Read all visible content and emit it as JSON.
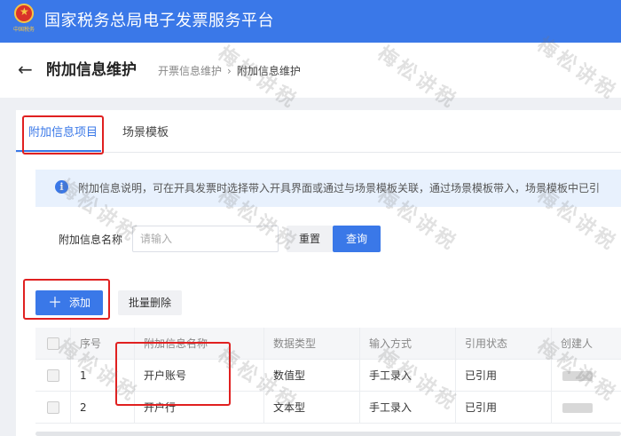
{
  "app": {
    "title": "国家税务总局电子发票服务平台",
    "emblem_text": "中国税务",
    "primary_color": "#3a78e8"
  },
  "header": {
    "back_icon": "arrow-left-icon",
    "page_title": "附加信息维护",
    "breadcrumb": [
      "开票信息维护",
      "附加信息维护"
    ],
    "breadcrumb_sep": "›"
  },
  "tabs": [
    {
      "label": "附加信息项目",
      "active": true
    },
    {
      "label": "场景模板",
      "active": false
    }
  ],
  "notice": {
    "icon": "info-icon",
    "text": "附加信息说明，可在开具发票时选择带入开具界面或通过与场景模板关联，通过场景模板带入，场景模板中已引"
  },
  "filter": {
    "label": "附加信息名称",
    "placeholder": "请输入",
    "value": "",
    "reset_label": "重置",
    "query_label": "查询"
  },
  "actions": {
    "add_label": "添加",
    "bulk_delete_label": "批量删除"
  },
  "table": {
    "columns": [
      "",
      "序号",
      "附加信息名称",
      "数据类型",
      "输入方式",
      "引用状态",
      "创建人"
    ],
    "rows": [
      {
        "index": "1",
        "name": "开户账号",
        "type": "数值型",
        "input": "手工录入",
        "status": "已引用",
        "creator": ""
      },
      {
        "index": "2",
        "name": "开户行",
        "type": "文本型",
        "input": "手工录入",
        "status": "已引用",
        "creator": ""
      }
    ]
  },
  "watermark": "梅松讲税",
  "highlight_color": "#e02020"
}
